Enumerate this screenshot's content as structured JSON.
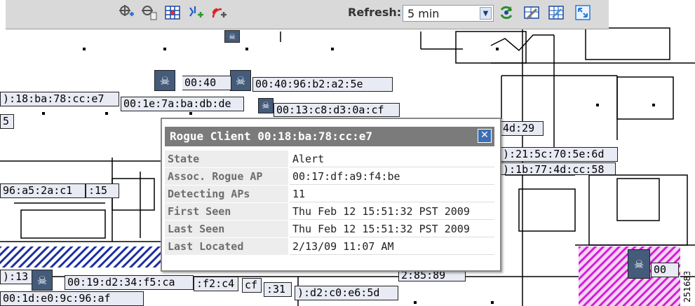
{
  "toolbar": {
    "icons": [
      "add-ap-icon",
      "add-device-icon",
      "grid-icon",
      "add-client-icon",
      "add-rogue-icon",
      "refresh-now-icon",
      "map-editor-icon",
      "reports-icon",
      "fullscreen-icon"
    ],
    "refresh_label": "Refresh:",
    "refresh_value": "5 min"
  },
  "tags": {
    "t1": "):18:ba:78:cc:e7",
    "t2": "00:1e:7a:ba:db:de",
    "t3": "00:40",
    "t4": "00:40:96:b2:a2:5e",
    "t5": "00:13:c8:d3:0a:cf",
    "t6": "4d:29",
    "t7": "):21:5c:70:5e:6d",
    "t8": "):1b:77:4d:cc:58",
    "t9": "96:a5:2a:c1",
    "t10": ":15",
    "t11": "5",
    "t12": "):13",
    "t13": "00:19:d2:34:f5:ca",
    "t14": ":f2:c4",
    "t15": "cf",
    "t16": ":31",
    "t17": "):d2:c0:e6:5d",
    "t18": "2:85:89",
    "t19": "00",
    "t20": "00:1d:e0:9c:96:af"
  },
  "popup": {
    "title": "Rogue Client 00:18:ba:78:cc:e7",
    "close_icon": "close-icon",
    "rows": [
      {
        "label": "State",
        "value": "Alert"
      },
      {
        "label": "Assoc. Rogue AP",
        "value": "00:17:df:a9:f4:be"
      },
      {
        "label": "Detecting APs",
        "value": "11"
      },
      {
        "label": "First Seen",
        "value": "Thu Feb 12 15:51:32 PST 2009"
      },
      {
        "label": "Last Seen",
        "value": "Thu Feb 12 15:51:32 PST 2009"
      },
      {
        "label": "Last Located",
        "value": "2/13/09 11:07 AM"
      }
    ]
  },
  "figure_number": "251683",
  "colors": {
    "toolbar_bg": "#d9d9d9",
    "popup_header": "#7b7b7b",
    "tag_bg": "#e8eaf4",
    "skull_bg": "#445b7a",
    "hatch_blue": "#1c2fa0",
    "hatch_magenta": "#d21fd6"
  }
}
